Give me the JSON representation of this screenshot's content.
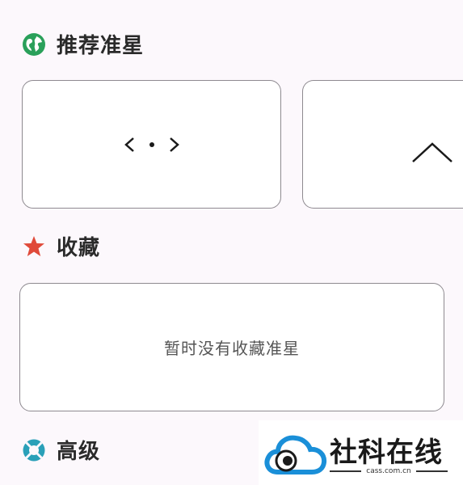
{
  "sections": {
    "recommended": {
      "title": "推荐准星",
      "icon": "globe-icon"
    },
    "favorites": {
      "title": "收藏",
      "icon": "star-icon",
      "empty_text": "暂时没有收藏准星"
    },
    "advanced": {
      "title": "高级",
      "icon": "lifebuoy-icon"
    }
  },
  "crosshairs": [
    {
      "name": "crosshair-angle-dot",
      "glyph": "<·>"
    },
    {
      "name": "crosshair-chevron-up",
      "glyph": "^"
    }
  ],
  "watermark": {
    "brand": "社科在线",
    "domain": "cass.com.cn"
  },
  "colors": {
    "globe": "#2aa05a",
    "star": "#e04a3a",
    "lifebuoy": "#2aa0b8",
    "watermark_blue": "#1a8fd8"
  }
}
